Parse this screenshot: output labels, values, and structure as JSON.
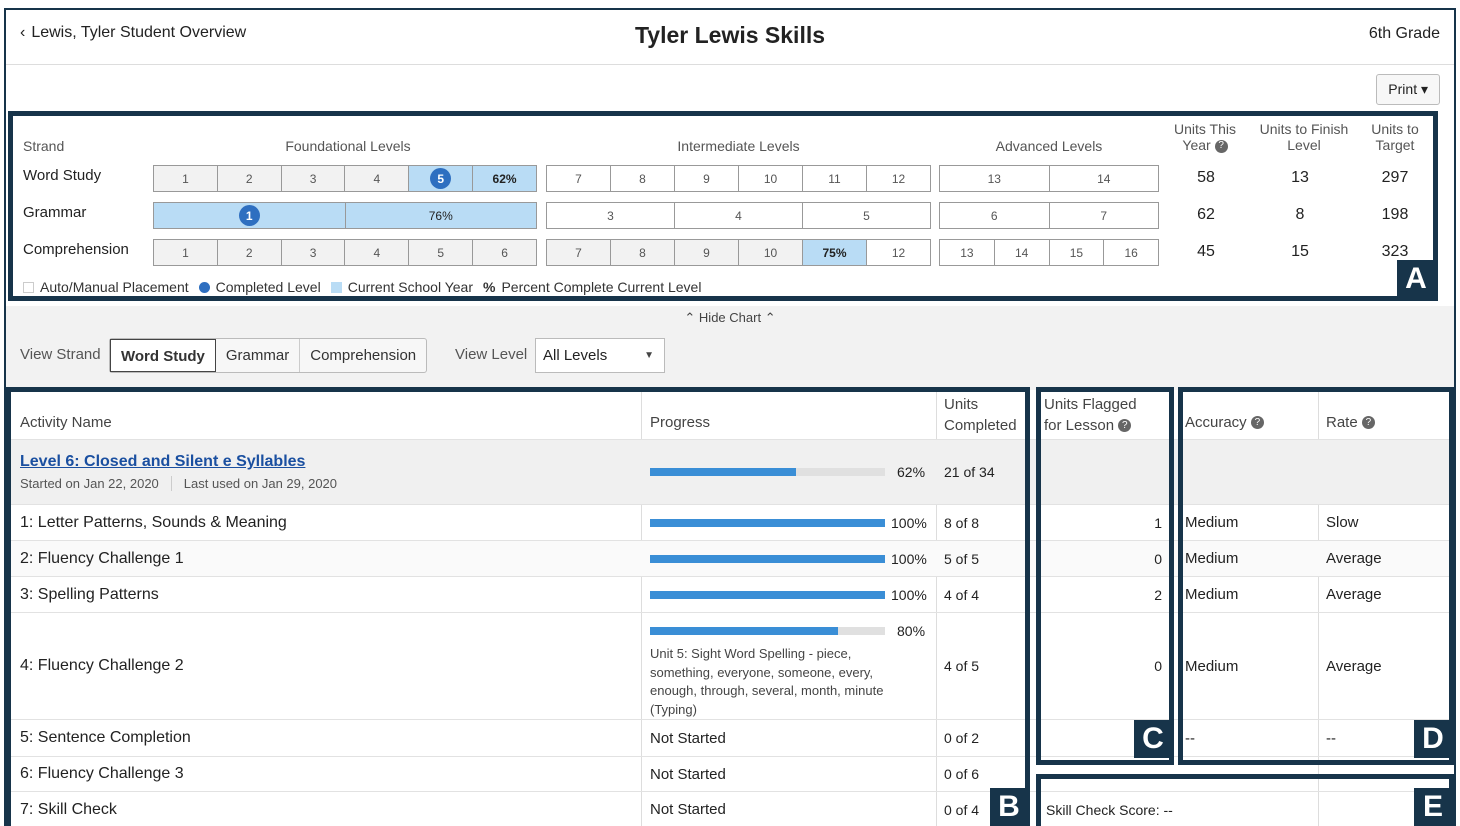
{
  "header": {
    "back_label": "Lewis, Tyler Student Overview",
    "title": "Tyler Lewis Skills",
    "grade": "6th Grade",
    "print_label": "Print ▾"
  },
  "chart": {
    "strand_label": "Strand",
    "foundational_label": "Foundational Levels",
    "intermediate_label": "Intermediate Levels",
    "advanced_label": "Advanced Levels",
    "units_this_year_label": "Units This Year",
    "units_to_finish_label": "Units to Finish Level",
    "units_to_target_label": "Units to Target",
    "rows": [
      {
        "name": "Word Study",
        "foundational": [
          "1",
          "2",
          "3",
          "4",
          "5",
          "62%"
        ],
        "intermediate": [
          "7",
          "8",
          "9",
          "10",
          "11",
          "12"
        ],
        "advanced": [
          "13",
          "14"
        ],
        "units_this_year": "58",
        "units_to_finish": "13",
        "units_to_target": "297"
      },
      {
        "name": "Grammar",
        "foundational": [
          "1",
          "76%"
        ],
        "intermediate": [
          "3",
          "4",
          "5"
        ],
        "advanced": [
          "6",
          "7"
        ],
        "units_this_year": "62",
        "units_to_finish": "8",
        "units_to_target": "198"
      },
      {
        "name": "Comprehension",
        "foundational": [
          "1",
          "2",
          "3",
          "4",
          "5",
          "6"
        ],
        "intermediate": [
          "7",
          "8",
          "9",
          "10",
          "75%",
          "12"
        ],
        "advanced": [
          "13",
          "14",
          "15",
          "16"
        ],
        "units_this_year": "45",
        "units_to_finish": "15",
        "units_to_target": "323"
      }
    ],
    "legend": {
      "auto_manual": "Auto/Manual Placement",
      "completed": "Completed Level",
      "current_year": "Current School Year",
      "percent_symbol": "%",
      "percent_complete": "Percent Complete Current Level"
    },
    "corner_label": "A",
    "hide_chart_label": "Hide Chart"
  },
  "filters": {
    "view_strand_label": "View Strand",
    "strands": [
      "Word Study",
      "Grammar",
      "Comprehension"
    ],
    "active_strand": "Word Study",
    "view_level_label": "View Level",
    "level_value": "All Levels"
  },
  "table": {
    "headers": {
      "activity": "Activity Name",
      "progress": "Progress",
      "units_completed_1": "Units",
      "units_completed_2": "Completed",
      "flagged_1": "Units Flagged",
      "flagged_2": "for Lesson",
      "accuracy": "Accuracy",
      "rate": "Rate"
    },
    "level_row": {
      "title": "Level 6: Closed and Silent e Syllables",
      "started": "Started on Jan 22, 2020",
      "last_used": "Last used on Jan 29, 2020",
      "progress": 0.62,
      "progress_label": "62%",
      "units": "21 of 34"
    },
    "rows": [
      {
        "name": "1: Letter Patterns, Sounds & Meaning",
        "progress": 1.0,
        "progress_label": "100%",
        "units": "8 of 8",
        "flagged": "1",
        "accuracy": "Medium",
        "rate": "Slow"
      },
      {
        "name": "2: Fluency Challenge 1",
        "progress": 1.0,
        "progress_label": "100%",
        "units": "5 of 5",
        "flagged": "0",
        "accuracy": "Medium",
        "rate": "Average"
      },
      {
        "name": "3: Spelling Patterns",
        "progress": 1.0,
        "progress_label": "100%",
        "units": "4 of 4",
        "flagged": "2",
        "accuracy": "Medium",
        "rate": "Average"
      },
      {
        "name": "4: Fluency Challenge 2",
        "progress": 0.8,
        "progress_label": "80%",
        "note": "Unit 5: Sight Word Spelling - piece, something, everyone, someone, every, enough, through, several, month, minute (Typing)",
        "units": "4 of 5",
        "flagged": "0",
        "accuracy": "Medium",
        "rate": "Average"
      },
      {
        "name": "5: Sentence Completion",
        "status": "Not Started",
        "units": "0 of 2",
        "flagged": "",
        "accuracy": "--",
        "rate": "--"
      },
      {
        "name": "6: Fluency Challenge 3",
        "status": "Not Started",
        "units": "0 of 6"
      },
      {
        "name": "7: Skill Check",
        "status": "Not Started",
        "units": "0 of 4"
      }
    ],
    "skill_check_score": "Skill Check Score: --",
    "corners": {
      "b": "B",
      "c": "C",
      "d": "D",
      "e": "E"
    }
  },
  "colors": {
    "frame": "#17344a",
    "progress_fill": "#3a8ed6",
    "current_year": "#b9dcf5",
    "completed_dot": "#2e6fc0",
    "link": "#1a4fa0"
  }
}
